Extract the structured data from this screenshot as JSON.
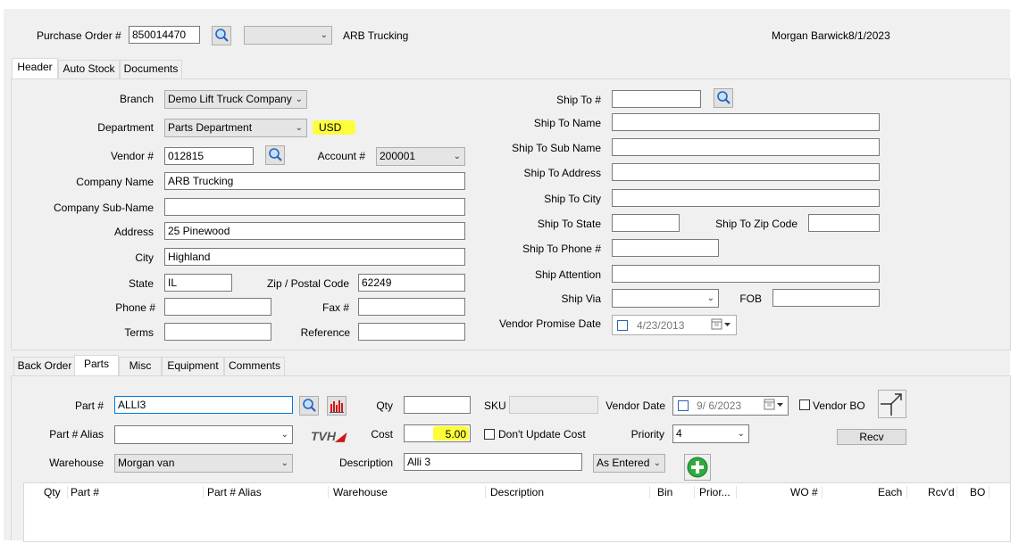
{
  "po": {
    "label": "Purchase Order #",
    "number": "850014470",
    "vendor_name": "ARB Trucking",
    "user_date": "Morgan Barwick8/1/2023"
  },
  "top_tabs": [
    "Header",
    "Auto Stock",
    "Documents"
  ],
  "header": {
    "branch_label": "Branch",
    "branch_value": "Demo Lift Truck Company",
    "department_label": "Department",
    "department_value": "Parts Department",
    "currency": "USD",
    "vendor_label": "Vendor #",
    "vendor_value": "012815",
    "account_label": "Account #",
    "account_value": "200001",
    "company_name_label": "Company Name",
    "company_name_value": "ARB Trucking",
    "company_subname_label": "Company Sub-Name",
    "company_subname_value": "",
    "address_label": "Address",
    "address_value": "25 Pinewood",
    "city_label": "City",
    "city_value": "Highland",
    "state_label": "State",
    "state_value": "IL",
    "zip_label": "Zip / Postal Code",
    "zip_value": "62249",
    "phone_label": "Phone #",
    "phone_value": "",
    "fax_label": "Fax #",
    "fax_value": "",
    "terms_label": "Terms",
    "terms_value": "",
    "reference_label": "Reference",
    "reference_value": "",
    "ship_to_label": "Ship To #",
    "ship_to_name_label": "Ship To Name",
    "ship_to_subname_label": "Ship To Sub Name",
    "ship_to_address_label": "Ship To Address",
    "ship_to_city_label": "Ship To City",
    "ship_to_state_label": "Ship To State",
    "ship_to_zip_label": "Ship To Zip Code",
    "ship_to_phone_label": "Ship To Phone #",
    "ship_attention_label": "Ship Attention",
    "ship_via_label": "Ship Via",
    "fob_label": "FOB",
    "vendor_promise_label": "Vendor Promise Date",
    "vendor_promise_value": "4/23/2013"
  },
  "bottom_tabs": [
    "Back Order",
    "Parts",
    "Misc",
    "Equipment",
    "Comments"
  ],
  "parts": {
    "part_label": "Part #",
    "part_value": "ALLI3",
    "qty_label": "Qty",
    "qty_value": "",
    "sku_label": "SKU",
    "vendor_date_label": "Vendor Date",
    "vendor_date_value": "9/ 6/2023",
    "vendor_bo_label": "Vendor BO",
    "alias_label": "Part # Alias",
    "tvh_logo": "TVH",
    "cost_label": "Cost",
    "cost_value": "5.00",
    "dont_update_cost_label": "Don't Update Cost",
    "priority_label": "Priority",
    "priority_value": "4",
    "recv_button": "Recv",
    "warehouse_label": "Warehouse",
    "warehouse_value": "Morgan van",
    "description_label": "Description",
    "description_value": "Alli 3",
    "as_entered_value": "As Entered"
  },
  "grid_columns": [
    "Qty",
    "Part #",
    "Part # Alias",
    "Warehouse",
    "Description",
    "Bin",
    "Prior...",
    "WO #",
    "Each",
    "Rcv'd",
    "BO"
  ],
  "colors": {
    "highlight": "#fdfd3c",
    "window_bg": "#f0f0f0",
    "focus_border": "#0078d7",
    "add_button": "#2eaa3f"
  },
  "icons": [
    "search-icon",
    "chart-icon",
    "calendar-icon",
    "add-icon",
    "resize-icon",
    "tvh-logo"
  ]
}
